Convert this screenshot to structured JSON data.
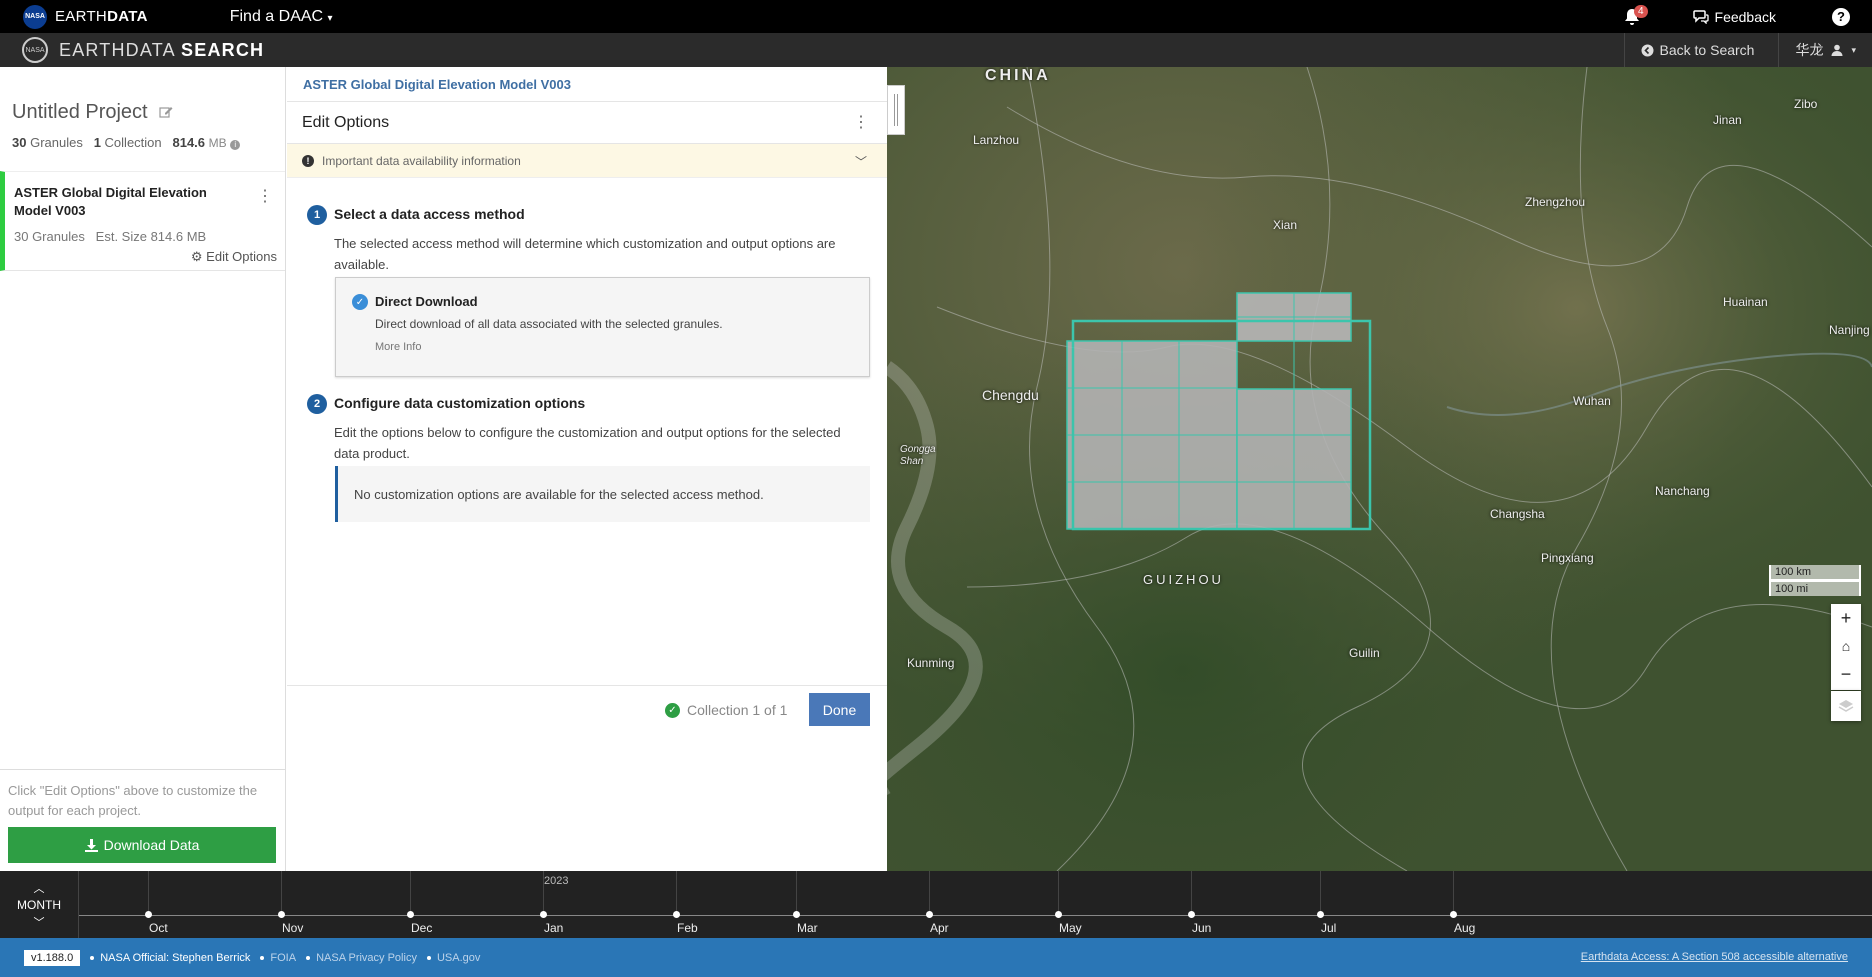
{
  "topbar": {
    "nasa_logo": "NASA",
    "brand_prefix": "EARTH",
    "brand_suffix": "DATA",
    "find_daac": "Find a DAAC",
    "notification_count": "4",
    "feedback": "Feedback",
    "help": "?"
  },
  "subbar": {
    "brand_light": "EARTHDATA ",
    "brand_bold": "SEARCH",
    "back_to_search": "Back to Search",
    "user_name": "华龙"
  },
  "sidebar": {
    "project_title": "Untitled Project",
    "granules": "30",
    "granules_label": "Granules",
    "collections": "1",
    "collections_label": "Collection",
    "size": "814.6",
    "size_unit": "MB",
    "collection": {
      "title": "ASTER Global Digital Elevation Model V003",
      "meta": "30 Granules   Est. Size 814.6 MB",
      "edit_options": "Edit Options"
    },
    "footer_hint": "Click \"Edit Options\" above to customize the output for each project.",
    "download_button": "Download Data"
  },
  "panel": {
    "breadcrumb": "ASTER Global Digital Elevation Model V003",
    "heading": "Edit Options",
    "notice": "Important data availability information",
    "step1": {
      "num": "1",
      "title": "Select a data access method",
      "desc": "The selected access method will determine which customization and output options are available."
    },
    "method": {
      "title": "Direct Download",
      "desc": "Direct download of all data associated with the selected granules.",
      "more": "More Info"
    },
    "step2": {
      "num": "2",
      "title": "Configure data customization options",
      "desc": "Edit the options below to configure the customization and output options for the selected data product."
    },
    "no_options": "No customization options are available for the selected access method.",
    "collection_count": "Collection 1 of 1",
    "done_button": "Done"
  },
  "map": {
    "labels": {
      "china": "CHINA",
      "lanzhou": "Lanzhou",
      "xian": "Xian",
      "zhengzhou": "Zhengzhou",
      "jinan": "Jinan",
      "zibo": "Zibo",
      "huainan": "Huainan",
      "nanjing": "Nanjing",
      "chengdu": "Chengdu",
      "gongga": "Gongga Shan",
      "wuhan": "Wuhan",
      "nanchang": "Nanchang",
      "changsha": "Changsha",
      "pingxiang": "Pingxiang",
      "guizhou": "GUIZHOU",
      "guilin": "Guilin",
      "kunming": "Kunming"
    },
    "scale_km": "100 km",
    "scale_mi": "100 mi",
    "zoom_in": "+",
    "home": "⌂",
    "zoom_out": "−"
  },
  "timeline": {
    "interval": "MONTH",
    "year": "2023",
    "months": [
      "Oct",
      "Nov",
      "Dec",
      "Jan",
      "Feb",
      "Mar",
      "Apr",
      "May",
      "Jun",
      "Jul",
      "Aug"
    ]
  },
  "footer": {
    "version": "v1.188.0",
    "official": "NASA Official: Stephen Berrick",
    "foia": "FOIA",
    "privacy": "NASA Privacy Policy",
    "usagov": "USA.gov",
    "section508": "Earthdata Access: A Section 508 accessible alternative"
  },
  "colors": {
    "granule_outline": "#39d0b8",
    "download_green": "#2e9e44",
    "accent_blue": "#1f5f9f",
    "footer_blue": "#2a76b6"
  }
}
